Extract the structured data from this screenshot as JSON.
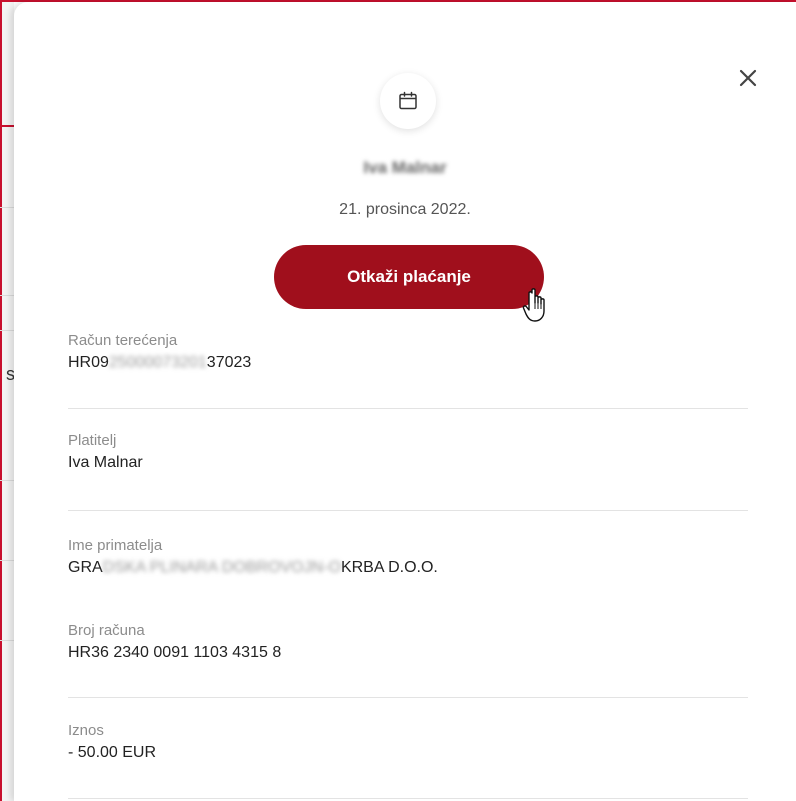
{
  "modal": {
    "close_symbol": "✕",
    "header_icon": "calendar-icon",
    "payer_name_obscured": "Iva Malnar",
    "date": "21. prosinca 2022.",
    "cancel_button_label": "Otkaži plaćanje"
  },
  "fields": {
    "debit_account": {
      "label": "Račun terećenja",
      "value_prefix": "HR09",
      "value_hidden": "25000073201",
      "value_suffix": "37023"
    },
    "payer": {
      "label": "Platitelj",
      "value": "Iva Malnar"
    },
    "recipient_name": {
      "label": "Ime primatelja",
      "value_prefix": "GRA",
      "value_hidden": "DSKA PLINARA DOBROVOJN-O",
      "value_suffix": "KRBA D.O.O."
    },
    "account_number": {
      "label": "Broj računa",
      "value": "HR36 2340 0091 1103 4315 8"
    },
    "amount": {
      "label": "Iznos",
      "value": "- 50.00 EUR"
    }
  },
  "background": {
    "peek_letter": "s"
  },
  "colors": {
    "primary_button": "#a00f1c",
    "brand_red": "#c8102e",
    "label_gray": "#8c8c8c",
    "value_text": "#222222",
    "separator": "#e3e3e3"
  }
}
